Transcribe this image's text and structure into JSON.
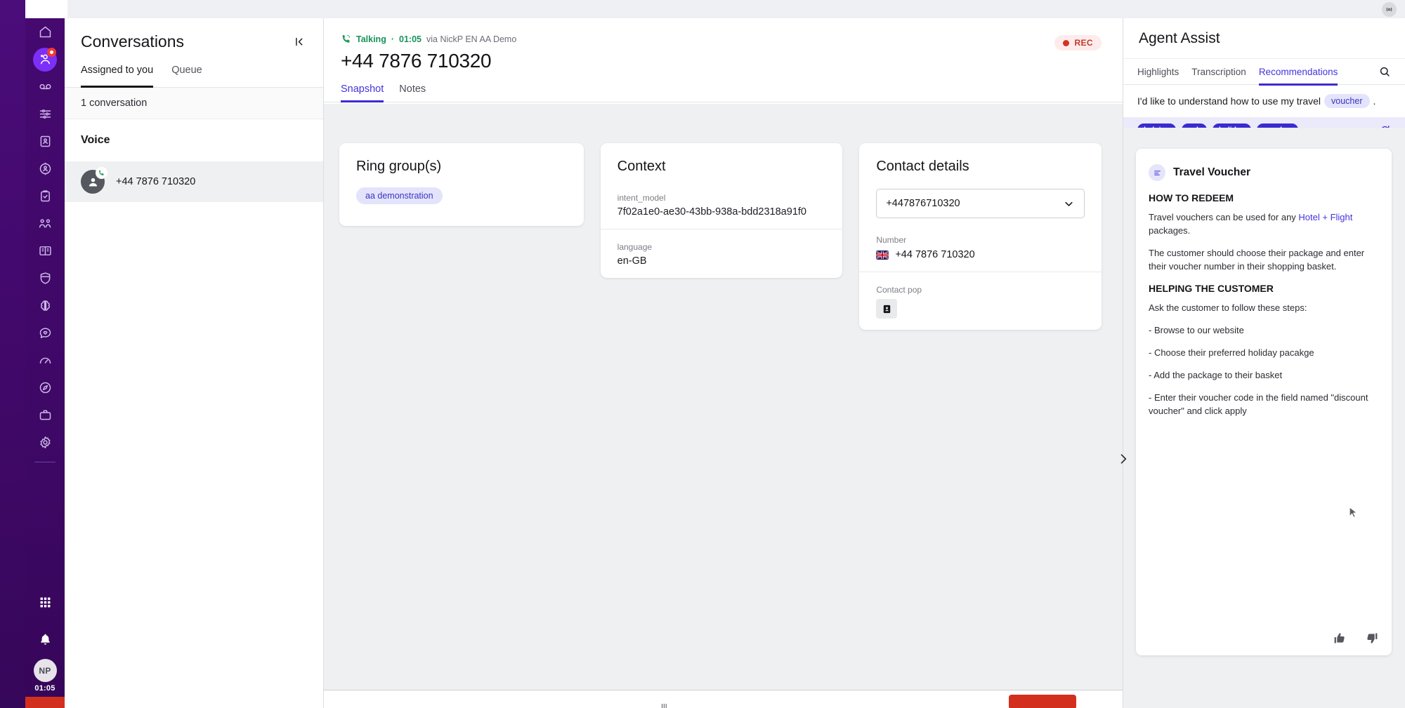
{
  "window": {
    "top_right_icon": "broadcast-icon"
  },
  "rail": {
    "items": [
      {
        "icon": "home-icon",
        "name": "home"
      },
      {
        "icon": "agent-headset-icon",
        "name": "conversations",
        "active": true,
        "badge": true
      },
      {
        "icon": "voicemail-icon",
        "name": "voicemail"
      },
      {
        "icon": "queue-list-icon",
        "name": "queues"
      },
      {
        "icon": "contact-card-icon",
        "name": "contacts"
      },
      {
        "icon": "target-user-icon",
        "name": "campaigns"
      },
      {
        "icon": "clipboard-check-icon",
        "name": "tasks"
      },
      {
        "icon": "people-group-icon",
        "name": "teams"
      },
      {
        "icon": "book-icon",
        "name": "knowledge"
      },
      {
        "icon": "shield-icon",
        "name": "quality"
      },
      {
        "icon": "brain-icon",
        "name": "ai"
      },
      {
        "icon": "chat-heart-icon",
        "name": "feedback"
      },
      {
        "icon": "gauge-icon",
        "name": "performance"
      },
      {
        "icon": "compass-icon",
        "name": "explore"
      },
      {
        "icon": "briefcase-icon",
        "name": "workspace"
      },
      {
        "icon": "gear-icon",
        "name": "settings"
      }
    ],
    "apps_icon": "grid-apps-icon",
    "bell_icon": "bell-icon",
    "avatar_initials": "NP",
    "timer": "01:05"
  },
  "conversations": {
    "title": "Conversations",
    "collapse_icon": "collapse-panel-icon",
    "tabs": [
      {
        "label": "Assigned to you",
        "active": true
      },
      {
        "label": "Queue",
        "active": false
      }
    ],
    "count_label": "1 conversation",
    "group_label": "Voice",
    "items": [
      {
        "number": "+44 7876 710320",
        "avatar_icon": "person-icon",
        "badge_icon": "phone-icon"
      }
    ]
  },
  "call": {
    "status_icon": "phone-in-call-icon",
    "status_label": "Talking",
    "separator": "·",
    "duration": "01:05",
    "via_text": "via NickP EN AA Demo",
    "number": "+44 7876 710320",
    "rec_label": "REC",
    "tabs": [
      {
        "label": "Snapshot",
        "active": true
      },
      {
        "label": "Notes",
        "active": false
      }
    ]
  },
  "cards": {
    "ring_groups": {
      "title": "Ring group(s)",
      "chips": [
        "aa demonstration"
      ]
    },
    "context": {
      "title": "Context",
      "rows": [
        {
          "label": "intent_model",
          "value": "7f02a1e0-ae30-43bb-938a-bdd2318a91f0"
        },
        {
          "label": "language",
          "value": "en-GB"
        }
      ]
    },
    "contact_details": {
      "title": "Contact details",
      "select_value": "+447876710320",
      "select_icon": "chevron-down-icon",
      "number_label": "Number",
      "number_value": "+44 7876 710320",
      "flag_icon": "uk-flag-icon",
      "contact_pop_label": "Contact pop",
      "contact_pop_icon": "contact-card-icon"
    }
  },
  "assist": {
    "title": "Agent Assist",
    "tabs": [
      {
        "label": "Highlights",
        "active": false
      },
      {
        "label": "Transcription",
        "active": false
      },
      {
        "label": "Recommendations",
        "active": true
      }
    ],
    "search_icon": "search-icon",
    "utterance": {
      "before": "I'd like to understand how to use my travel",
      "highlight": "voucher",
      "after": "."
    },
    "tags": [
      "helping",
      "ask",
      "holiday",
      "voucher"
    ],
    "refresh_icon": "refresh-icon",
    "panel_arrow_icon": "chevron-right-icon",
    "kb_card": {
      "icon": "article-icon",
      "title": "Travel Voucher",
      "section1_heading": "HOW TO REDEEM",
      "para1_before": "Travel vouchers can be used for any ",
      "para1_link": "Hotel + Flight",
      "para1_after": " packages.",
      "para2": "The customer should choose their package and enter their voucher number in their shopping basket.",
      "section2_heading": "HELPING THE CUSTOMER",
      "para3": "Ask the customer to follow these steps:",
      "steps": [
        "- Browse to our website",
        "- Choose their preferred holiday pacakge",
        "- Add the package to their basket",
        "- Enter their voucher code in the field named \"discount voucher\" and click apply"
      ],
      "thumbs_up_icon": "thumbs-up-icon",
      "thumbs_down_icon": "thumbs-down-icon"
    }
  }
}
